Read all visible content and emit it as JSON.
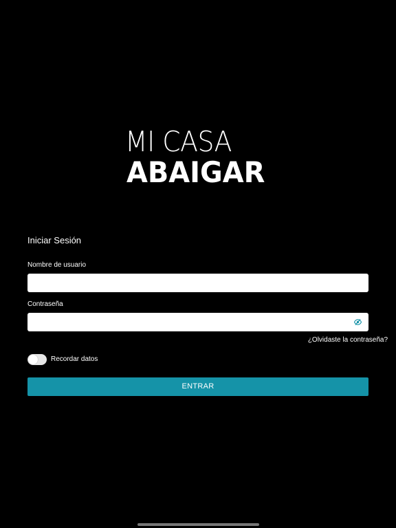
{
  "logo": {
    "line1": "MI CASA",
    "line2": "ABAIGAR"
  },
  "login": {
    "title": "Iniciar Sesión",
    "username_label": "Nombre de usuario",
    "username_value": "",
    "password_label": "Contraseña",
    "password_value": "",
    "password_visibility_icon": "eye-slash-icon",
    "forgot_link": "¿Olvidaste la contraseña?",
    "remember_label": "Recordar datos",
    "remember_enabled": false,
    "submit_label": "ENTRAR"
  },
  "colors": {
    "background": "#000000",
    "accent": "#1593a8",
    "text": "#ffffff"
  }
}
